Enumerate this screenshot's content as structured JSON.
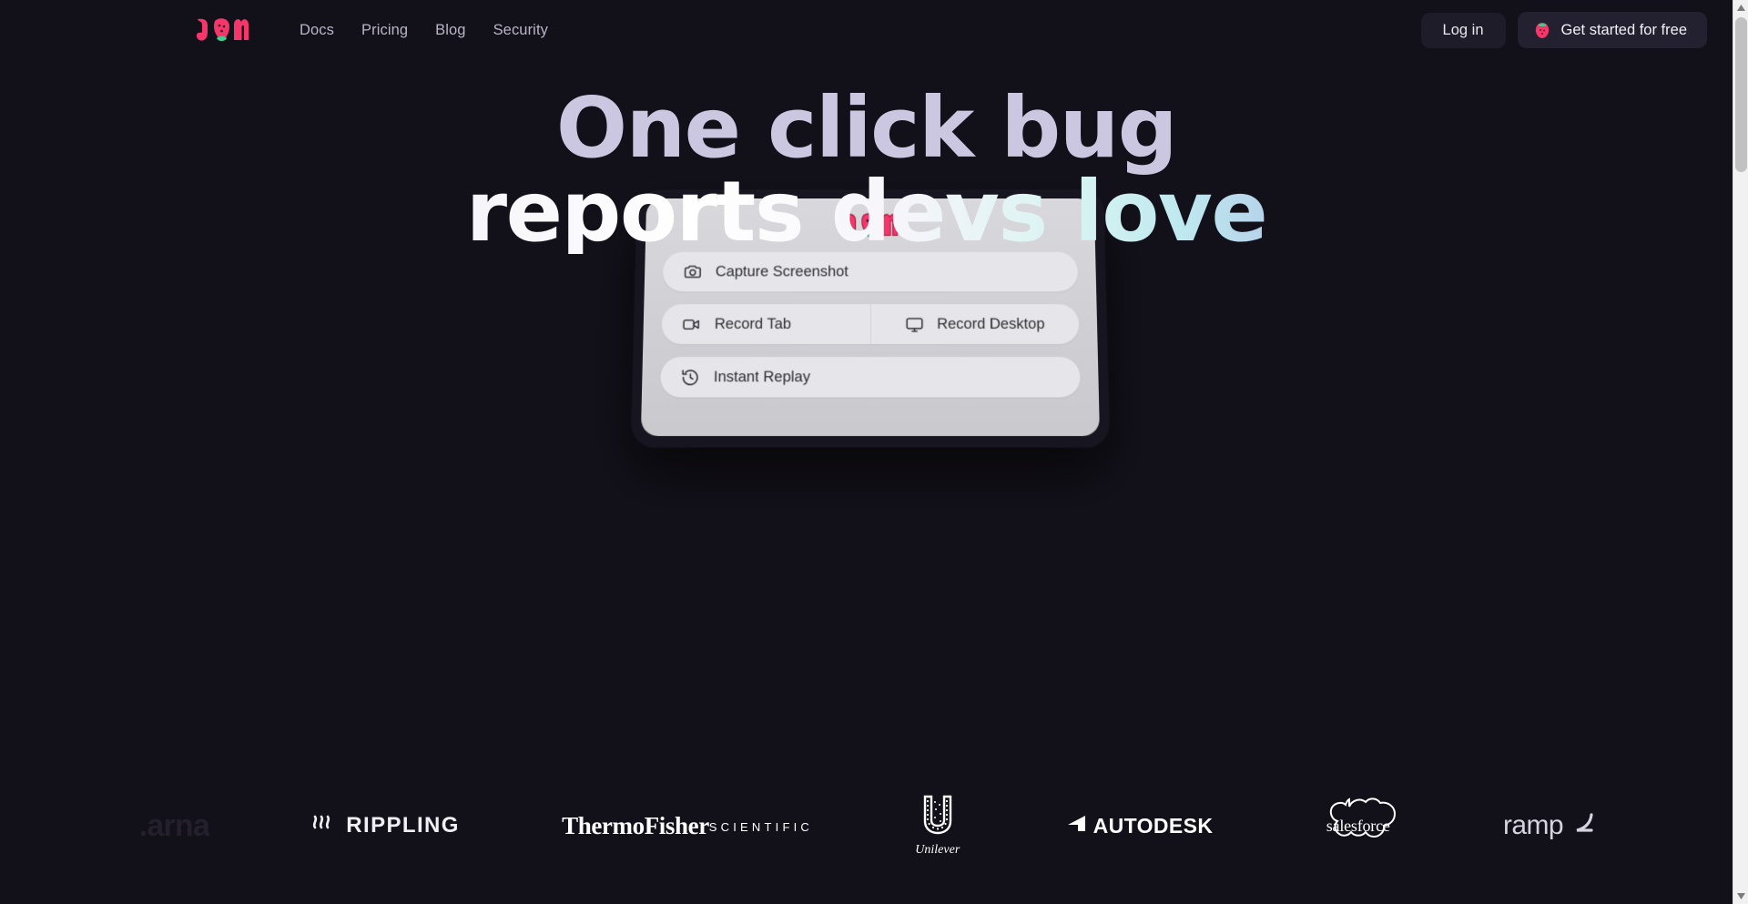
{
  "brand": {
    "name": "JAM",
    "logo_icon": "jam-strawberry-logo",
    "accent_pink": "#f4366a",
    "accent_green": "#3ecf8e",
    "background": "#121019"
  },
  "header": {
    "nav": [
      {
        "label": "Docs"
      },
      {
        "label": "Pricing"
      },
      {
        "label": "Blog"
      },
      {
        "label": "Security"
      }
    ],
    "login_label": "Log in",
    "cta_label": "Get started for free",
    "cta_icon": "strawberry-icon"
  },
  "hero": {
    "headline_line1": "One click bug",
    "headline_line2": "reports devs love",
    "gradient_start": "#a49fc4",
    "gradient_mid": "#ffffff",
    "gradient_cyan": "#bfe9ef",
    "gradient_end": "#9a7de2"
  },
  "widget": {
    "logo_icon": "jam-strawberry-logo",
    "actions": [
      {
        "label": "Capture Screenshot",
        "icon": "camera-icon"
      },
      {
        "label": "Record Tab",
        "icon": "video-camera-icon"
      },
      {
        "label": "Record Desktop",
        "icon": "monitor-icon"
      },
      {
        "label": "Instant Replay",
        "icon": "rewind-clock-icon"
      }
    ]
  },
  "customer_logos": [
    {
      "name": "Klarna",
      "text": "arna."
    },
    {
      "name": "Rippling",
      "text": "RIPPLING"
    },
    {
      "name": "Thermo Fisher Scientific",
      "text": "ThermoFisher",
      "subtext": "SCIENTIFIC"
    },
    {
      "name": "Unilever",
      "text": "Unilever"
    },
    {
      "name": "Autodesk",
      "text": "AUTODESK"
    },
    {
      "name": "Salesforce",
      "text": "salesforce"
    },
    {
      "name": "Ramp",
      "text": "ramp"
    }
  ],
  "scrollbar": {
    "up_arrow": "▲",
    "down_arrow": "▼"
  }
}
